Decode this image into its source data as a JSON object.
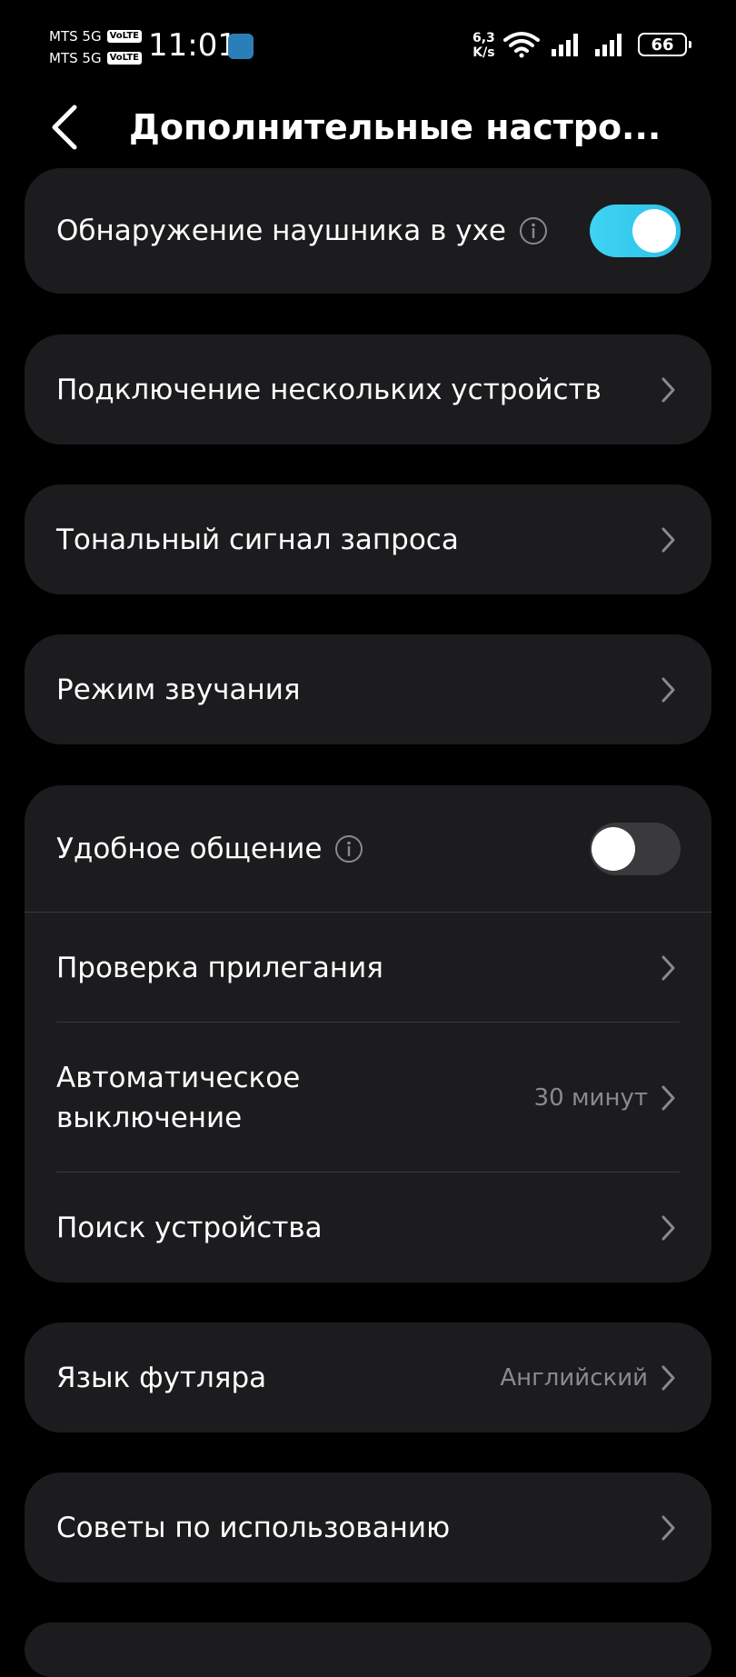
{
  "status_bar": {
    "carrier_1": "MTS 5G",
    "carrier_2": "MTS 5G",
    "volte_label": "VoLTE",
    "time": "11:01",
    "speed_value": "6,3",
    "speed_unit": "K/s",
    "battery": "66",
    "icons": [
      "app-notification-icon",
      "wifi-icon",
      "signal-icon",
      "signal-icon",
      "battery-icon"
    ]
  },
  "header": {
    "title": "Дополнительные настро..."
  },
  "settings": {
    "ear_detection": {
      "label": "Обнаружение наушника в ухе",
      "enabled": true
    },
    "multi_device": {
      "label": "Подключение нескольких устройств"
    },
    "prompt_tone": {
      "label": "Тональный сигнал запроса"
    },
    "sound_mode": {
      "label": "Режим звучания"
    },
    "easy_talk": {
      "label": "Удобное общение",
      "enabled": false
    },
    "fit_test": {
      "label": "Проверка прилегания"
    },
    "auto_off": {
      "label_line1": "Автоматическое",
      "label_line2": "выключение",
      "value": "30 минут"
    },
    "find_device": {
      "label": "Поиск устройства"
    },
    "case_language": {
      "label": "Язык футляра",
      "value": "Английский"
    },
    "usage_tips": {
      "label": "Советы по использованию"
    }
  },
  "colors": {
    "background": "#000000",
    "card": "#1c1c1e",
    "toggle_on": "#2cc0ea",
    "secondary_text": "#8a8a8d"
  }
}
